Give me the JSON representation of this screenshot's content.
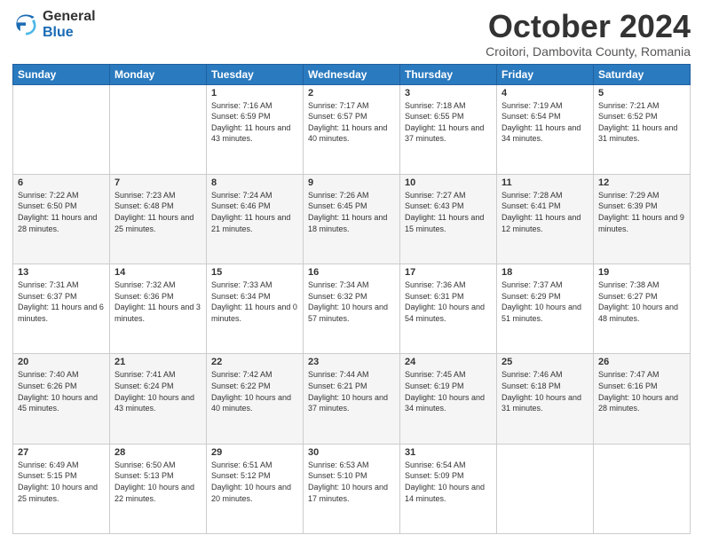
{
  "logo": {
    "general": "General",
    "blue": "Blue"
  },
  "title": "October 2024",
  "subtitle": "Croitori, Dambovita County, Romania",
  "weekdays": [
    "Sunday",
    "Monday",
    "Tuesday",
    "Wednesday",
    "Thursday",
    "Friday",
    "Saturday"
  ],
  "weeks": [
    [
      {
        "day": "",
        "sunrise": "",
        "sunset": "",
        "daylight": ""
      },
      {
        "day": "",
        "sunrise": "",
        "sunset": "",
        "daylight": ""
      },
      {
        "day": "1",
        "sunrise": "Sunrise: 7:16 AM",
        "sunset": "Sunset: 6:59 PM",
        "daylight": "Daylight: 11 hours and 43 minutes."
      },
      {
        "day": "2",
        "sunrise": "Sunrise: 7:17 AM",
        "sunset": "Sunset: 6:57 PM",
        "daylight": "Daylight: 11 hours and 40 minutes."
      },
      {
        "day": "3",
        "sunrise": "Sunrise: 7:18 AM",
        "sunset": "Sunset: 6:55 PM",
        "daylight": "Daylight: 11 hours and 37 minutes."
      },
      {
        "day": "4",
        "sunrise": "Sunrise: 7:19 AM",
        "sunset": "Sunset: 6:54 PM",
        "daylight": "Daylight: 11 hours and 34 minutes."
      },
      {
        "day": "5",
        "sunrise": "Sunrise: 7:21 AM",
        "sunset": "Sunset: 6:52 PM",
        "daylight": "Daylight: 11 hours and 31 minutes."
      }
    ],
    [
      {
        "day": "6",
        "sunrise": "Sunrise: 7:22 AM",
        "sunset": "Sunset: 6:50 PM",
        "daylight": "Daylight: 11 hours and 28 minutes."
      },
      {
        "day": "7",
        "sunrise": "Sunrise: 7:23 AM",
        "sunset": "Sunset: 6:48 PM",
        "daylight": "Daylight: 11 hours and 25 minutes."
      },
      {
        "day": "8",
        "sunrise": "Sunrise: 7:24 AM",
        "sunset": "Sunset: 6:46 PM",
        "daylight": "Daylight: 11 hours and 21 minutes."
      },
      {
        "day": "9",
        "sunrise": "Sunrise: 7:26 AM",
        "sunset": "Sunset: 6:45 PM",
        "daylight": "Daylight: 11 hours and 18 minutes."
      },
      {
        "day": "10",
        "sunrise": "Sunrise: 7:27 AM",
        "sunset": "Sunset: 6:43 PM",
        "daylight": "Daylight: 11 hours and 15 minutes."
      },
      {
        "day": "11",
        "sunrise": "Sunrise: 7:28 AM",
        "sunset": "Sunset: 6:41 PM",
        "daylight": "Daylight: 11 hours and 12 minutes."
      },
      {
        "day": "12",
        "sunrise": "Sunrise: 7:29 AM",
        "sunset": "Sunset: 6:39 PM",
        "daylight": "Daylight: 11 hours and 9 minutes."
      }
    ],
    [
      {
        "day": "13",
        "sunrise": "Sunrise: 7:31 AM",
        "sunset": "Sunset: 6:37 PM",
        "daylight": "Daylight: 11 hours and 6 minutes."
      },
      {
        "day": "14",
        "sunrise": "Sunrise: 7:32 AM",
        "sunset": "Sunset: 6:36 PM",
        "daylight": "Daylight: 11 hours and 3 minutes."
      },
      {
        "day": "15",
        "sunrise": "Sunrise: 7:33 AM",
        "sunset": "Sunset: 6:34 PM",
        "daylight": "Daylight: 11 hours and 0 minutes."
      },
      {
        "day": "16",
        "sunrise": "Sunrise: 7:34 AM",
        "sunset": "Sunset: 6:32 PM",
        "daylight": "Daylight: 10 hours and 57 minutes."
      },
      {
        "day": "17",
        "sunrise": "Sunrise: 7:36 AM",
        "sunset": "Sunset: 6:31 PM",
        "daylight": "Daylight: 10 hours and 54 minutes."
      },
      {
        "day": "18",
        "sunrise": "Sunrise: 7:37 AM",
        "sunset": "Sunset: 6:29 PM",
        "daylight": "Daylight: 10 hours and 51 minutes."
      },
      {
        "day": "19",
        "sunrise": "Sunrise: 7:38 AM",
        "sunset": "Sunset: 6:27 PM",
        "daylight": "Daylight: 10 hours and 48 minutes."
      }
    ],
    [
      {
        "day": "20",
        "sunrise": "Sunrise: 7:40 AM",
        "sunset": "Sunset: 6:26 PM",
        "daylight": "Daylight: 10 hours and 45 minutes."
      },
      {
        "day": "21",
        "sunrise": "Sunrise: 7:41 AM",
        "sunset": "Sunset: 6:24 PM",
        "daylight": "Daylight: 10 hours and 43 minutes."
      },
      {
        "day": "22",
        "sunrise": "Sunrise: 7:42 AM",
        "sunset": "Sunset: 6:22 PM",
        "daylight": "Daylight: 10 hours and 40 minutes."
      },
      {
        "day": "23",
        "sunrise": "Sunrise: 7:44 AM",
        "sunset": "Sunset: 6:21 PM",
        "daylight": "Daylight: 10 hours and 37 minutes."
      },
      {
        "day": "24",
        "sunrise": "Sunrise: 7:45 AM",
        "sunset": "Sunset: 6:19 PM",
        "daylight": "Daylight: 10 hours and 34 minutes."
      },
      {
        "day": "25",
        "sunrise": "Sunrise: 7:46 AM",
        "sunset": "Sunset: 6:18 PM",
        "daylight": "Daylight: 10 hours and 31 minutes."
      },
      {
        "day": "26",
        "sunrise": "Sunrise: 7:47 AM",
        "sunset": "Sunset: 6:16 PM",
        "daylight": "Daylight: 10 hours and 28 minutes."
      }
    ],
    [
      {
        "day": "27",
        "sunrise": "Sunrise: 6:49 AM",
        "sunset": "Sunset: 5:15 PM",
        "daylight": "Daylight: 10 hours and 25 minutes."
      },
      {
        "day": "28",
        "sunrise": "Sunrise: 6:50 AM",
        "sunset": "Sunset: 5:13 PM",
        "daylight": "Daylight: 10 hours and 22 minutes."
      },
      {
        "day": "29",
        "sunrise": "Sunrise: 6:51 AM",
        "sunset": "Sunset: 5:12 PM",
        "daylight": "Daylight: 10 hours and 20 minutes."
      },
      {
        "day": "30",
        "sunrise": "Sunrise: 6:53 AM",
        "sunset": "Sunset: 5:10 PM",
        "daylight": "Daylight: 10 hours and 17 minutes."
      },
      {
        "day": "31",
        "sunrise": "Sunrise: 6:54 AM",
        "sunset": "Sunset: 5:09 PM",
        "daylight": "Daylight: 10 hours and 14 minutes."
      },
      {
        "day": "",
        "sunrise": "",
        "sunset": "",
        "daylight": ""
      },
      {
        "day": "",
        "sunrise": "",
        "sunset": "",
        "daylight": ""
      }
    ]
  ]
}
